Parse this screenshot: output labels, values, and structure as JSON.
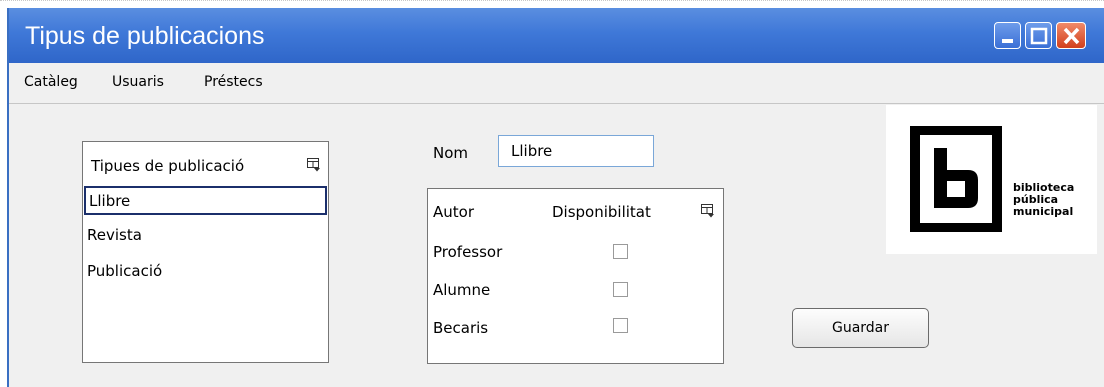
{
  "window": {
    "title": "Tipus de publicacions",
    "controls": [
      "minimize-icon",
      "maximize-icon",
      "close-icon"
    ]
  },
  "menu": {
    "items": [
      "Catàleg",
      "Usuaris",
      "Préstecs"
    ]
  },
  "types_table": {
    "header": "Tipues de publicació",
    "column_picker_icon": "column-picker-icon",
    "rows": [
      "Llibre",
      "Revista",
      "Publicació"
    ],
    "selected_index": 0
  },
  "name_field": {
    "label": "Nom",
    "value": "Llibre"
  },
  "availability_table": {
    "headers": [
      "Autor",
      "Disponibilitat"
    ],
    "column_picker_icon": "column-picker-icon",
    "rows": [
      {
        "autor": "Professor",
        "disponibilitat": false
      },
      {
        "autor": "Alumne",
        "disponibilitat": false
      },
      {
        "autor": "Becaris",
        "disponibilitat": false
      }
    ]
  },
  "logo": {
    "lines": [
      "biblioteca",
      "pública",
      "municipal"
    ]
  },
  "buttons": {
    "save_label": "Guardar"
  },
  "colors": {
    "titlebar": "#3f78d8",
    "close_button": "#d2401c",
    "selection_border": "#1b2f6b"
  }
}
